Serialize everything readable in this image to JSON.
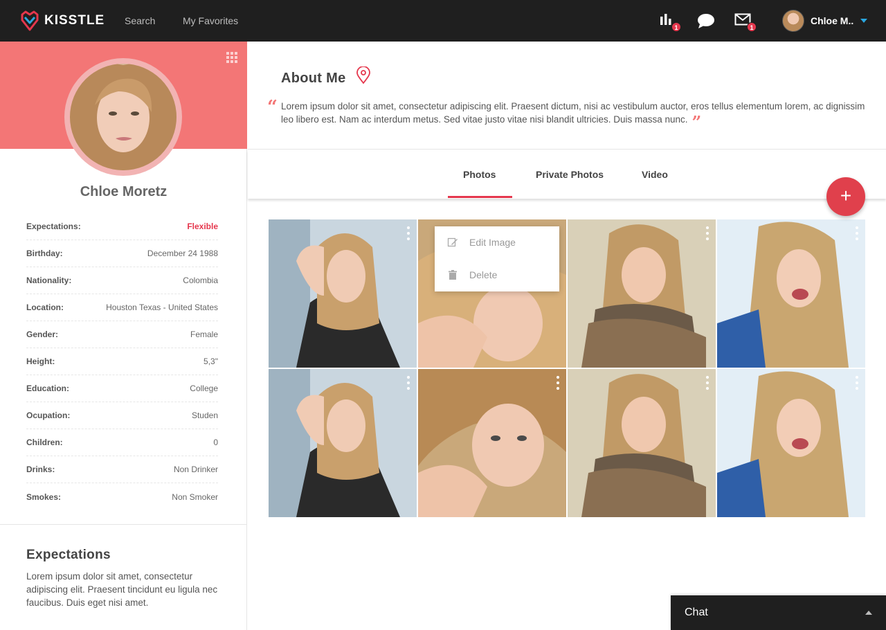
{
  "app": {
    "brand": "KISSTLE",
    "accent": "#e5374d",
    "cover_color": "#f37676",
    "logo_icon": "heart-diamond-logo"
  },
  "nav": {
    "search": "Search",
    "favorites": "My Favorites"
  },
  "header_icons": {
    "stats": {
      "icon": "bar-chart-icon",
      "badge": "1"
    },
    "chat": {
      "icon": "chat-bubble-icon"
    },
    "mail": {
      "icon": "mail-icon",
      "badge": "1"
    }
  },
  "user_menu": {
    "name": "Chloe M.."
  },
  "profile": {
    "name": "Chloe Moretz",
    "details": [
      {
        "label": "Expectations:",
        "value": "Flexible"
      },
      {
        "label": "Birthday:",
        "value": "December 24 1988"
      },
      {
        "label": "Nationality:",
        "value": "Colombia"
      },
      {
        "label": "Location:",
        "value": "Houston Texas - United States"
      },
      {
        "label": "Gender:",
        "value": "Female"
      },
      {
        "label": "Height:",
        "value": "5,3\""
      },
      {
        "label": "Education:",
        "value": "College"
      },
      {
        "label": "Ocupation:",
        "value": "Studen"
      },
      {
        "label": "Children:",
        "value": "0"
      },
      {
        "label": "Drinks:",
        "value": "Non Drinker"
      },
      {
        "label": "Smokes:",
        "value": "Non Smoker"
      }
    ]
  },
  "expectations": {
    "title": "Expectations",
    "text": "Lorem ipsum dolor sit amet, consectetur adipiscing elit. Praesent tincidunt eu ligula nec faucibus. Duis eget nisi amet."
  },
  "about": {
    "title": "About Me",
    "text": "Lorem ipsum dolor sit amet, consectetur adipiscing elit. Praesent dictum, nisi ac vestibulum auctor, eros tellus elementum lorem, ac dignissim leo libero est. Nam ac interdum metus. Sed vitae justo vitae nisi blandit ultricies. Duis massa nunc."
  },
  "tabs": [
    {
      "label": "Photos",
      "active": true
    },
    {
      "label": "Private Photos",
      "active": false
    },
    {
      "label": "Video",
      "active": false
    }
  ],
  "add_button": "+",
  "context_menu": {
    "edit": "Edit Image",
    "delete": "Delete"
  },
  "photos_count": 8,
  "chat": {
    "label": "Chat"
  }
}
